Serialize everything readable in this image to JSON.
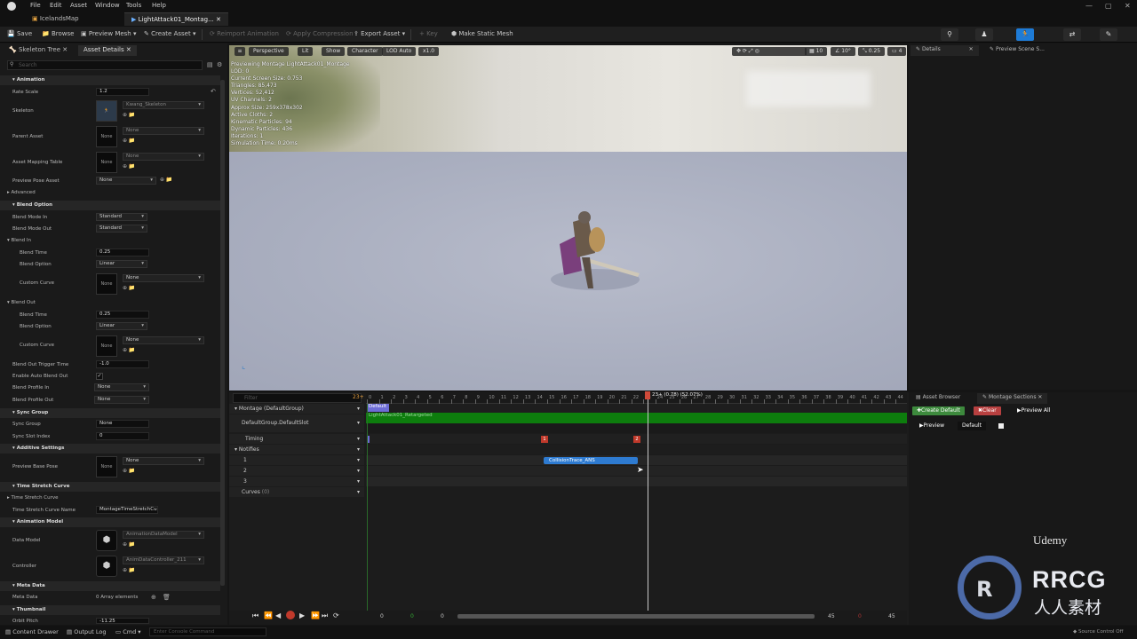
{
  "menu": [
    "File",
    "Edit",
    "Asset",
    "Window",
    "Tools",
    "Help"
  ],
  "tabs": [
    {
      "label": "IcelandsMap"
    },
    {
      "label": "LightAttack01_Montag..."
    }
  ],
  "toolbar": {
    "save": "Save",
    "browse": "Browse",
    "preview_mesh": "Preview Mesh",
    "create_asset": "Create Asset",
    "reimport": "Reimport Animation",
    "apply_compression": "Apply Compression",
    "export_asset": "Export Asset",
    "key": "Key",
    "make_static_mesh": "Make Static Mesh"
  },
  "left_panel": {
    "tabs": [
      "Skeleton Tree",
      "Asset Details"
    ],
    "search_placeholder": "Search",
    "sections": {
      "animation": "Animation",
      "blend_option": "Blend Option",
      "sync_group": "Sync Group",
      "additive": "Additive Settings",
      "time_stretch": "Time Stretch Curve",
      "anim_model": "Animation Model",
      "meta": "Meta Data",
      "thumbnail": "Thumbnail"
    },
    "labels": {
      "rate_scale": "Rate Scale",
      "skeleton": "Skeleton",
      "parent_asset": "Parent Asset",
      "asset_mapping": "Asset Mapping Table",
      "preview_pose": "Preview Pose Asset",
      "advanced": "Advanced",
      "blend_mode_in": "Blend Mode In",
      "blend_mode_out": "Blend Mode Out",
      "blend_in": "Blend In",
      "blend_time": "Blend Time",
      "blend_option": "Blend Option",
      "custom_curve": "Custom Curve",
      "blend_out": "Blend Out",
      "blend_out_trigger": "Blend Out Trigger Time",
      "enable_auto_blend": "Enable Auto Blend Out",
      "blend_profile_in": "Blend Profile In",
      "blend_profile_out": "Blend Profile Out",
      "sync_group": "Sync Group",
      "sync_slot": "Sync Slot Index",
      "preview_base_pose": "Preview Base Pose",
      "time_stretch_curve": "Time Stretch Curve",
      "time_stretch_curve_name": "Time Stretch Curve Name",
      "data_model": "Data Model",
      "controller": "Controller",
      "meta_data": "Meta Data",
      "orbit_pitch": "Orbit Pitch"
    },
    "values": {
      "rate_scale": "1.2",
      "skeleton": "Kwang_Skeleton",
      "none": "None",
      "standard": "Standard",
      "blend_in_time": "0.25",
      "linear": "Linear",
      "blend_out_time": "0.25",
      "trigger": "-1.0",
      "sync_slot": "0",
      "time_stretch_name": "MontageTimeStretchCurve",
      "data_model": "AnimationDataModel",
      "controller": "AnimDataController_211",
      "array_elements": "0 Array elements",
      "orbit_pitch": "-11.25"
    }
  },
  "viewport": {
    "buttons": [
      "Perspective",
      "Lit",
      "Show",
      "Character",
      "LOD Auto",
      "x1.0"
    ],
    "right_values": [
      "10",
      "10°",
      "0.25",
      "4"
    ],
    "stats": [
      "Previewing Montage LightAttack01_Montage",
      "LOD: 0",
      "Current Screen Size: 0.753",
      "Triangles: 85,473",
      "Vertices: 52,412",
      "UV Channels: 2",
      "Approx Size: 259x378x302",
      "Active Cloths: 2",
      "Kinematic Particles: 94",
      "Dynamic Particles: 436",
      "Iterations: 1",
      "Simulation Time: 0.20ms"
    ]
  },
  "right_panel": {
    "tabs": [
      "Details",
      "Preview Scene S..."
    ]
  },
  "montage_panel": {
    "tabs": [
      "Asset Browser",
      "Montage Sections"
    ],
    "create_default": "Create Default",
    "clear": "Clear",
    "preview_all": "Preview All",
    "preview": "Preview",
    "default": "Default"
  },
  "timeline": {
    "filter_placeholder": "Filter",
    "count": "23+",
    "ticks": [
      "0",
      "1",
      "2",
      "3",
      "4",
      "5",
      "6",
      "7",
      "8",
      "9",
      "10",
      "11",
      "12",
      "13",
      "14",
      "15",
      "16",
      "17",
      "18",
      "19",
      "20",
      "21",
      "22",
      "23",
      "24",
      "25",
      "26",
      "27",
      "28",
      "29",
      "30",
      "31",
      "32",
      "33",
      "34",
      "35",
      "36",
      "37",
      "38",
      "39",
      "40",
      "41",
      "42",
      "43",
      "44"
    ],
    "playhead": "23+ (0.78) (52.07%)",
    "tracks": {
      "montage": "Montage (DefaultGroup)",
      "slot": "DefaultGroup.DefaultSlot",
      "timing": "Timing",
      "notifies": "Notifies",
      "n1": "1",
      "n2": "2",
      "n3": "3",
      "curves": "Curves",
      "curves_count": "(0)"
    },
    "section_label": "Default",
    "segment_label": "LightAttack01_Retargeted",
    "timing_markers": [
      "1",
      "2"
    ],
    "notify": "CollisionTrace_ANS",
    "transport_values": [
      "0",
      "0",
      "0",
      "45",
      "0",
      "45"
    ]
  },
  "bottom_bar": {
    "content_drawer": "Content Drawer",
    "output_log": "Output Log",
    "cmd": "Cmd",
    "console_placeholder": "Enter Console Command",
    "source_control": "Source Control Off"
  },
  "watermark": {
    "title": "RRCG",
    "subtitle": "人人素材",
    "udemy": "Udemy"
  }
}
